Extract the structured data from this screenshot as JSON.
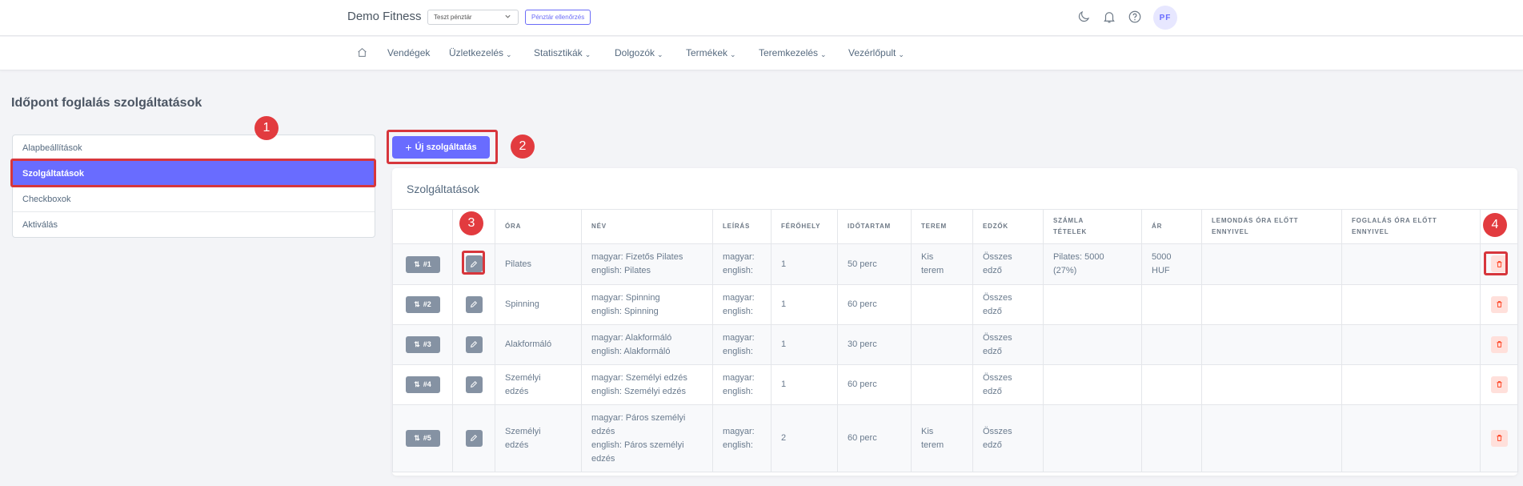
{
  "topbar": {
    "brand": "Demo Fitness",
    "cash_register": "Teszt pénztár",
    "cash_check_label": "Pénztár ellenőrzés",
    "avatar_initials": "PF"
  },
  "menu": {
    "items": [
      {
        "label": "Vendégek",
        "has_caret": false
      },
      {
        "label": "Üzletkezelés",
        "has_caret": true
      },
      {
        "label": "Statisztikák",
        "has_caret": true
      },
      {
        "label": "Dolgozók",
        "has_caret": true
      },
      {
        "label": "Termékek",
        "has_caret": true
      },
      {
        "label": "Teremkezelés",
        "has_caret": true
      },
      {
        "label": "Vezérlőpult",
        "has_caret": true
      }
    ]
  },
  "page": {
    "title": "Időpont foglalás szolgáltatások"
  },
  "sidebar": {
    "items": [
      {
        "label": "Alapbeállítások",
        "active": false
      },
      {
        "label": "Szolgáltatások",
        "active": true
      },
      {
        "label": "Checkboxok",
        "active": false
      },
      {
        "label": "Aktiválás",
        "active": false
      }
    ]
  },
  "actions": {
    "new_service_label": "Új szolgáltatás"
  },
  "annotations": [
    "1",
    "2",
    "3",
    "4"
  ],
  "card": {
    "title": "Szolgáltatások"
  },
  "table": {
    "headers": {
      "ora": "ÓRA",
      "nev": "NÉV",
      "leiras": "LEÍRÁS",
      "ferohely": "FÉRŐHELY",
      "idotartam": "IDŐTARTAM",
      "terem": "TEREM",
      "edzok": "EDZŐK",
      "szamla_1": "SZÁMLA",
      "szamla_2": "TÉTELEK",
      "ar": "ÁR",
      "lemondas_1": "LEMONDÁS ÓRA ELŐTT",
      "lemondas_2": "ENNYIVEL",
      "foglalas_1": "FOGLALÁS ÓRA ELŐTT",
      "foglalas_2": "ENNYIVEL"
    },
    "rows": [
      {
        "order": "#1",
        "ora": "Pilates",
        "nev_1": "magyar: Fizetős Pilates",
        "nev_2": "english: Pilates",
        "leiras_1": "magyar:",
        "leiras_2": "english:",
        "ferohely": "1",
        "idotartam": "50 perc",
        "terem_1": "Kis",
        "terem_2": "terem",
        "edzok_1": "Összes",
        "edzok_2": "edző",
        "szamla_1": "Pilates: 5000",
        "szamla_2": "(27%)",
        "ar_1": "5000",
        "ar_2": "HUF"
      },
      {
        "order": "#2",
        "ora": "Spinning",
        "nev_1": "magyar: Spinning",
        "nev_2": "english: Spinning",
        "leiras_1": "magyar:",
        "leiras_2": "english:",
        "ferohely": "1",
        "idotartam": "60 perc",
        "edzok_1": "Összes",
        "edzok_2": "edző"
      },
      {
        "order": "#3",
        "ora": "Alakformáló",
        "nev_1": "magyar: Alakformáló",
        "nev_2": "english: Alakformáló",
        "leiras_1": "magyar:",
        "leiras_2": "english:",
        "ferohely": "1",
        "idotartam": "30 perc",
        "edzok_1": "Összes",
        "edzok_2": "edző"
      },
      {
        "order": "#4",
        "ora_1": "Személyi",
        "ora_2": "edzés",
        "nev_1": "magyar: Személyi edzés",
        "nev_2": "english: Személyi edzés",
        "leiras_1": "magyar:",
        "leiras_2": "english:",
        "ferohely": "1",
        "idotartam": "60 perc",
        "edzok_1": "Összes",
        "edzok_2": "edző"
      },
      {
        "order": "#5",
        "ora_1": "Személyi",
        "ora_2": "edzés",
        "nev_1": "magyar: Páros személyi",
        "nev_2": "edzés",
        "nev_3": "english: Páros személyi",
        "nev_4": "edzés",
        "leiras_1": "magyar:",
        "leiras_2": "english:",
        "ferohely": "2",
        "idotartam": "60 perc",
        "terem_1": "Kis",
        "terem_2": "terem",
        "edzok_1": "Összes",
        "edzok_2": "edző"
      }
    ]
  },
  "icons": {
    "moon": "moon-icon",
    "bell": "bell-icon",
    "help": "help-icon",
    "home": "home-icon",
    "sort": "sort-icon",
    "edit": "pencil-icon",
    "delete": "trash-icon"
  },
  "colors": {
    "primary": "#696cff",
    "highlight": "#d7363c",
    "badge": "#e23b3f",
    "secondary_btn": "#8592a3",
    "danger_soft": "#ffe0db"
  }
}
